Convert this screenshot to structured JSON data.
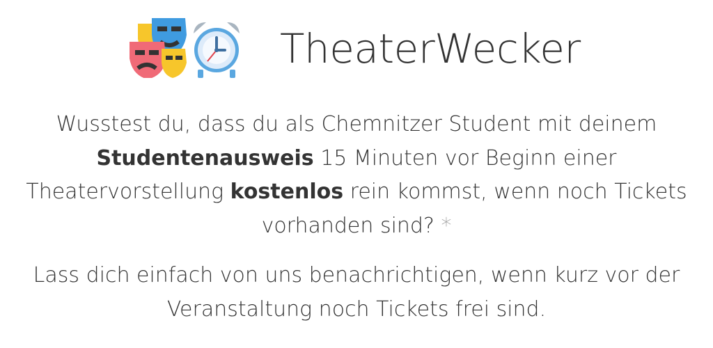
{
  "header": {
    "logo_icons": [
      "theater-masks-icon",
      "alarm-clock-icon"
    ],
    "title": "TheaterWecker"
  },
  "intro": {
    "part1": "Wusstest du, dass du als Chemnitzer Student mit deinem",
    "bold1": "Studentenausweis",
    "part2": "15 Minuten vor Beginn einer Theatervorstellung",
    "bold2": "kostenlos",
    "part3": "rein kommst, wenn noch Tickets vorhanden sind?",
    "footnote_mark": "*"
  },
  "cta": {
    "text": "Lass dich einfach von uns benachrichtigen, wenn kurz vor der Veranstaltung noch Tickets frei sind."
  },
  "colors": {
    "text": "#333333",
    "mask_red": "#F06A77",
    "mask_yellow": "#F7C62B",
    "mask_blue": "#3F9BE0",
    "clock_face": "#DDEBFA",
    "clock_blue": "#5AA7E0",
    "clock_gray": "#A9B5C0",
    "asterisk": "#999999"
  }
}
